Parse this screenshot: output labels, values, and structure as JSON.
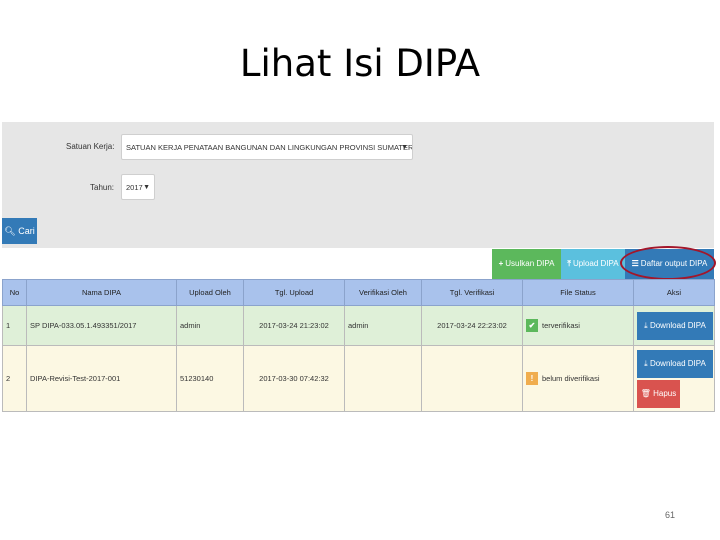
{
  "slide": {
    "title": "Lihat Isi DIPA",
    "page_number": "61"
  },
  "filters": {
    "satuan_kerja_label": "Satuan Kerja:",
    "satuan_kerja_value": "SATUAN KERJA PENATAAN BANGUNAN DAN LINGKUNGAN PROVINSI SUMATERA UTARA",
    "tahun_label": "Tahun:",
    "tahun_value": "2017",
    "search_button": "Cari"
  },
  "actions": {
    "usulkan": "Usulkan DIPA",
    "upload": "Upload DIPA",
    "daftar_output": "Daftar output DIPA"
  },
  "table": {
    "headers": [
      "No",
      "Nama DIPA",
      "Upload Oleh",
      "Tgl. Upload",
      "Verifikasi Oleh",
      "Tgl. Verifikasi",
      "File Status",
      "Aksi"
    ],
    "rows": [
      {
        "no": "1",
        "nama": "SP DIPA-033.05.1.493351/2017",
        "upload_oleh": "admin",
        "tgl_upload": "2017-03-24 21:23:02",
        "verifikasi_oleh": "admin",
        "tgl_verifikasi": "2017-03-24 22:23:02",
        "status_icon": "check-icon",
        "status": "terverifikasi",
        "download": "Download DIPA"
      },
      {
        "no": "2",
        "nama": "DIPA-Revisi-Test-2017-001",
        "upload_oleh": "51230140",
        "tgl_upload": "2017-03-30 07:42:32",
        "verifikasi_oleh": "",
        "tgl_verifikasi": "",
        "status_icon": "warning-icon",
        "status": "belum diverifikasi",
        "download": "Download DIPA",
        "delete": "Hapus"
      }
    ]
  },
  "colors": {
    "primary": "#337ab7",
    "success": "#5cb85c",
    "info": "#5bc0de",
    "danger": "#d9534f",
    "header": "#a9c2ec",
    "highlight": "#a3162a"
  }
}
